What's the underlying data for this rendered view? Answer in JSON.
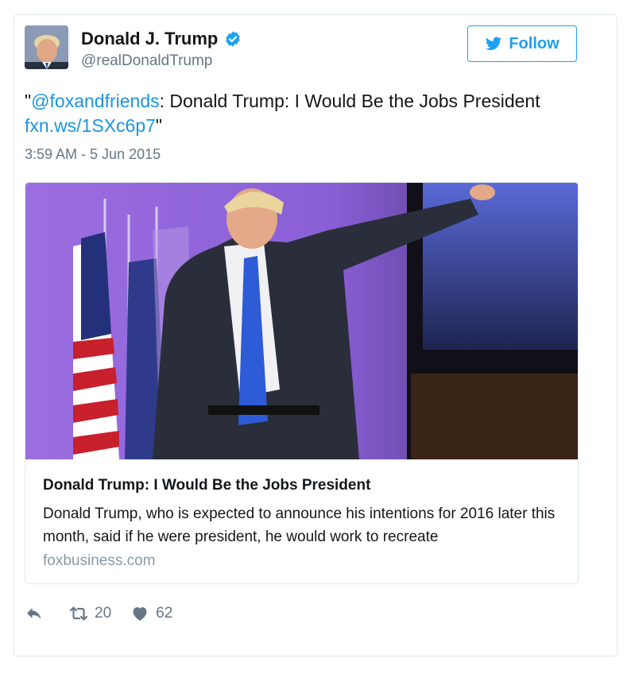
{
  "tweet": {
    "display_name": "Donald J. Trump",
    "handle": "@realDonaldTrump",
    "follow_label": "Follow",
    "text_prefix": "\"",
    "mention": "@foxandfriends",
    "text_body": ": Donald Trump: I Would Be the Jobs President",
    "url": "fxn.ws/1SXc6p7",
    "text_suffix": "\"",
    "timestamp": "3:59 AM - 5 Jun 2015"
  },
  "card": {
    "title": "Donald Trump: I Would Be the Jobs President",
    "description": "Donald Trump, who is expected to announce his intentions for 2016 later this month, said if he were president, he would work to recreate",
    "domain": "foxbusiness.com"
  },
  "actions": {
    "retweet_count": "20",
    "like_count": "62"
  },
  "colors": {
    "accent": "#1da1f2",
    "link": "#1b95e0",
    "muted": "#657786"
  }
}
